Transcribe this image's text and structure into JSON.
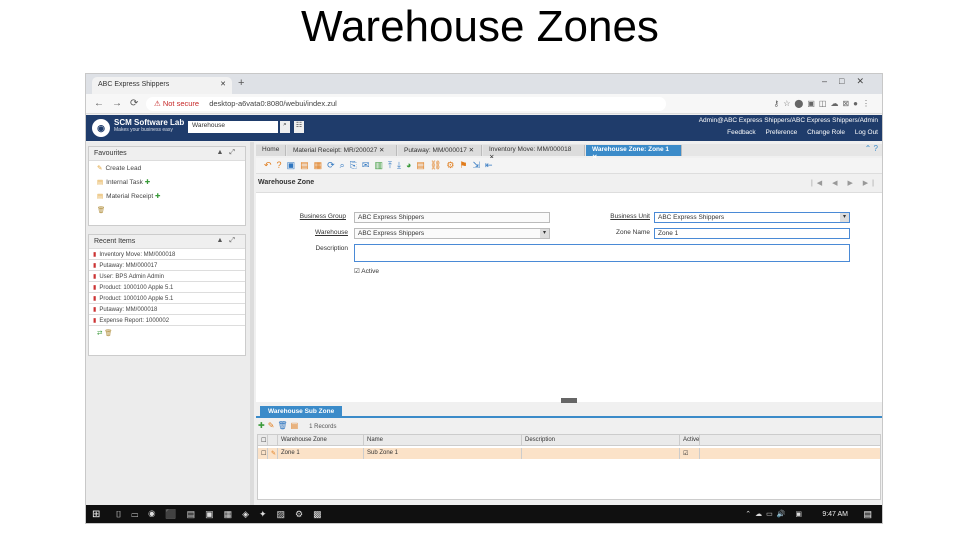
{
  "slide_title": "Warehouse Zones",
  "browser": {
    "tab_title": "ABC Express Shippers",
    "url_warning": "Not secure",
    "url": "desktop-a6vata0:8080/webui/index.zul"
  },
  "header": {
    "brand": "SCM Software Lab",
    "tagline": "Makes your business easy",
    "search_value": "Warehouse",
    "user": "Admin@ABC Express Shippers/ABC Express Shippers/Admin",
    "links": [
      "Feedback",
      "Preference",
      "Change Role",
      "Log Out"
    ]
  },
  "favourites": {
    "title": "Favourites",
    "items": [
      "Create Lead",
      "Internal Task",
      "Material Receipt"
    ]
  },
  "recent": {
    "title": "Recent Items",
    "items": [
      "Inventory Move: MM/000018",
      "Putaway: MM/000017",
      "User: BPS Admin Admin",
      "Product: 1000100 Apple 5.1",
      "Product: 1000100 Apple 5.1",
      "Putaway: MM/000018",
      "Expense Report: 1000002"
    ]
  },
  "window_tabs": [
    "Home",
    "Material Receipt: MR/200027",
    "Putaway: MM/000017",
    "Inventory Move: MM/000018",
    "Warehouse Zone: Zone 1"
  ],
  "form": {
    "title": "Warehouse Zone",
    "business_group_label": "Business Group",
    "business_group_value": "ABC Express Shippers",
    "business_unit_label": "Business Unit",
    "business_unit_value": "ABC Express Shippers",
    "warehouse_label": "Warehouse",
    "warehouse_value": "ABC Express Shippers",
    "zone_name_label": "Zone Name",
    "zone_name_value": "Zone 1",
    "description_label": "Description",
    "description_value": "",
    "active_label": "Active"
  },
  "subzone": {
    "tab": "Warehouse Sub Zone",
    "records": "1 Records",
    "columns": [
      "Warehouse Zone",
      "Name",
      "Description",
      "Active"
    ],
    "rows": [
      {
        "zone": "Zone 1",
        "name": "Sub Zone 1",
        "description": "",
        "active": "☑"
      }
    ]
  },
  "taskbar": {
    "clock": "9:47 AM"
  },
  "colors": {
    "header": "#1f3c6b",
    "accent": "#3b8bc9",
    "row_highlight": "#fbe2c8"
  }
}
